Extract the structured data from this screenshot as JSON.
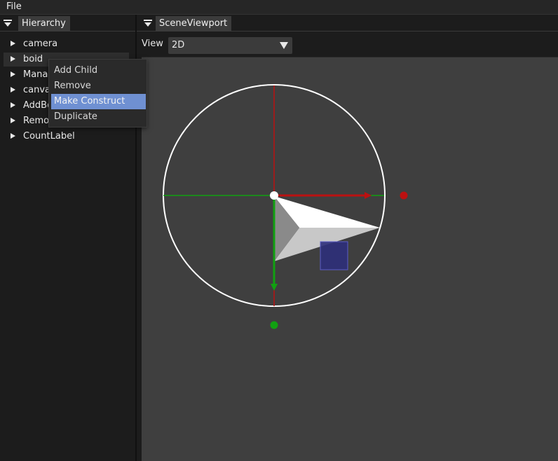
{
  "menubar": {
    "file_label": "File"
  },
  "hierarchy": {
    "tab_label": "Hierarchy",
    "items": [
      {
        "label": "camera"
      },
      {
        "label": "boid"
      },
      {
        "label": "Mana"
      },
      {
        "label": "canva"
      },
      {
        "label": "AddBo"
      },
      {
        "label": "Remo"
      },
      {
        "label": "CountLabel"
      }
    ]
  },
  "context_menu": {
    "items": [
      {
        "label": "Add Child"
      },
      {
        "label": "Remove"
      },
      {
        "label": "Make Construct",
        "selected": true
      },
      {
        "label": "Duplicate"
      }
    ]
  },
  "scene_viewport": {
    "tab_label": "SceneViewport",
    "view_label": "View",
    "view_mode": "2D",
    "view_options": [
      "2D"
    ]
  },
  "colors": {
    "x_axis": "#bb1111",
    "y_axis": "#11a011",
    "selection_box": "#2e2f7a",
    "highlight": "#6f90d2"
  }
}
